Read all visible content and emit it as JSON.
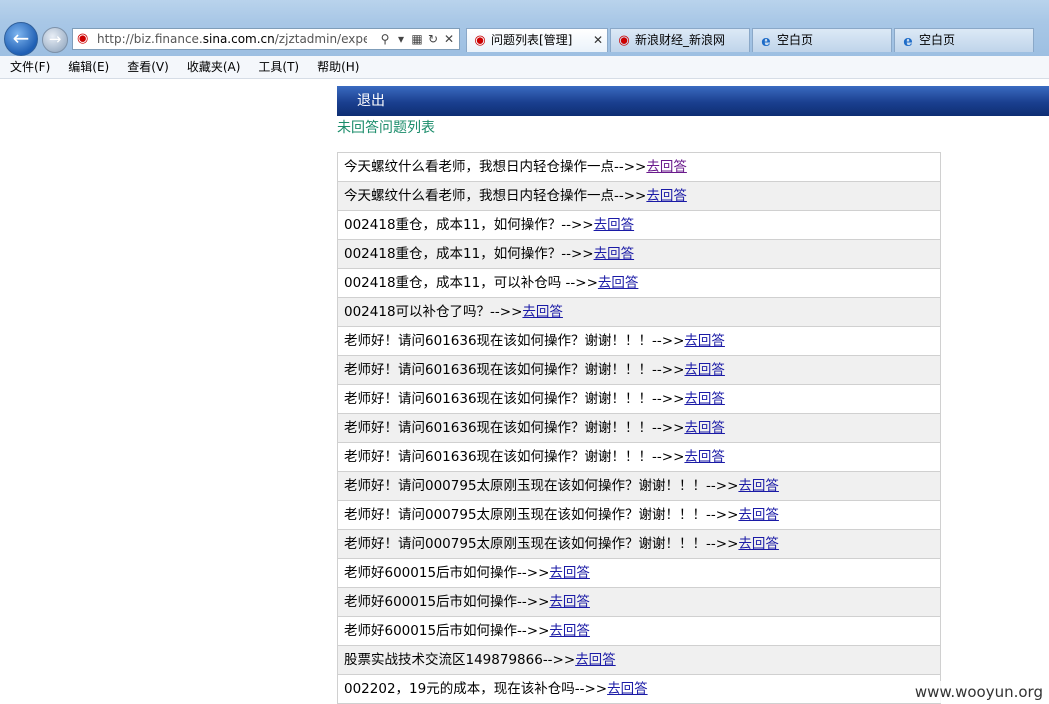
{
  "browser": {
    "address": {
      "url_prefix": "http://biz.finance.",
      "url_domain": "sina.com.cn",
      "url_path": "/zjztadmin/expert_c"
    },
    "tabs": [
      {
        "label": "问题列表[管理]",
        "icon": "sina-icon",
        "active": true,
        "closable": true
      },
      {
        "label": "新浪财经_新浪网",
        "icon": "sina-icon",
        "active": false,
        "closable": false
      },
      {
        "label": "空白页",
        "icon": "ie-icon",
        "active": false,
        "closable": false
      },
      {
        "label": "空白页",
        "icon": "ie-icon",
        "active": false,
        "closable": false
      }
    ],
    "menu": [
      "文件(F)",
      "编辑(E)",
      "查看(V)",
      "收藏夹(A)",
      "工具(T)",
      "帮助(H)"
    ]
  },
  "page": {
    "logout_label": "退出",
    "list_title": "未回答问题列表",
    "separator": "-->>",
    "answer_link": "去回答",
    "questions": [
      "今天螺纹什么看老师，我想日内轻仓操作一点",
      "今天螺纹什么看老师，我想日内轻仓操作一点",
      "002418重仓，成本11，如何操作？",
      "002418重仓，成本11，如何操作？",
      "002418重仓，成本11，可以补仓吗 ",
      "002418可以补仓了吗？",
      "老师好！请问601636现在该如何操作？谢谢！！！",
      "老师好！请问601636现在该如何操作？谢谢！！！",
      "老师好！请问601636现在该如何操作？谢谢！！！",
      "老师好！请问601636现在该如何操作？谢谢！！！",
      "老师好！请问601636现在该如何操作？谢谢！！！",
      "老师好！请问000795太原刚玉现在该如何操作？谢谢！！！",
      "老师好！请问000795太原刚玉现在该如何操作？谢谢！！！",
      "老师好！请问000795太原刚玉现在该如何操作？谢谢！！！",
      "老师好600015后市如何操作",
      "老师好600015后市如何操作",
      "老师好600015后市如何操作",
      "股票实战技术交流区149879866",
      "002202，19元的成本，现在该补仓吗"
    ]
  },
  "watermark": "www.wooyun.org"
}
